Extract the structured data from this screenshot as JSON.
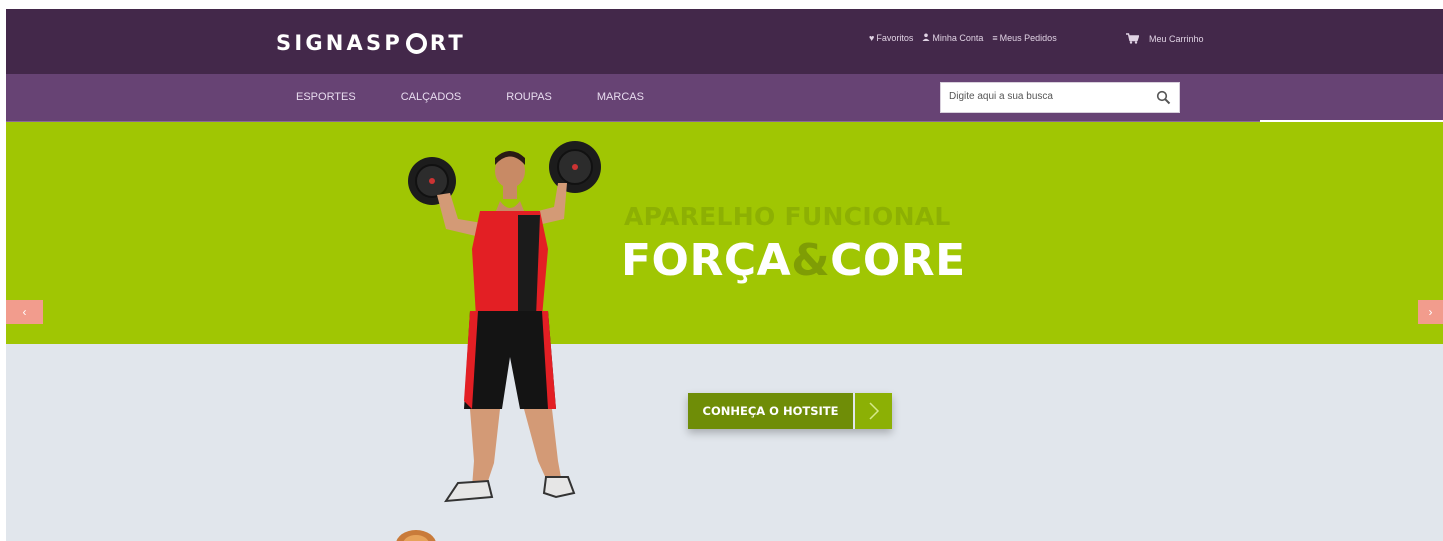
{
  "header": {
    "logo_text": "SIGNASPORT",
    "links": [
      {
        "label": "Favoritos",
        "icon": "heart-icon"
      },
      {
        "label": "Minha Conta",
        "icon": "user-icon"
      },
      {
        "label": "Meus Pedidos",
        "icon": "list-icon"
      }
    ],
    "cart_label": "Meu Carrinho",
    "cart_icon": "cart-icon"
  },
  "nav": {
    "items": [
      "ESPORTES",
      "CALÇADOS",
      "ROUPAS",
      "MARCAS"
    ],
    "search_placeholder": "Digite aqui a sua busca",
    "search_icon": "search-icon"
  },
  "hero": {
    "title_line1": "APARELHO FUNCIONAL",
    "title_line2_a": "FORÇA",
    "title_line2_amp": "&",
    "title_line2_b": "CORE",
    "cta_label": "CONHEÇA O HOTSITE",
    "prev_symbol": "‹",
    "next_symbol": "›"
  },
  "colors": {
    "header_bg": "#43284a",
    "nav_bg": "#674374",
    "hero_green": "#a0c603",
    "hero_grey": "#e1e6ec",
    "cta_dark": "#6f8d07",
    "slider_button": "#f29c8d"
  }
}
